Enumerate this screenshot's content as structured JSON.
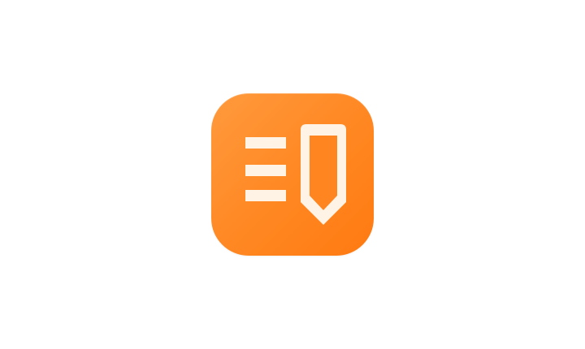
{
  "app_icon": {
    "icon": "notes-pencil-icon",
    "colors": {
      "background_top": "#ff9a3d",
      "background_bottom": "#ff7a10",
      "glyph": "#fff3e6"
    }
  }
}
